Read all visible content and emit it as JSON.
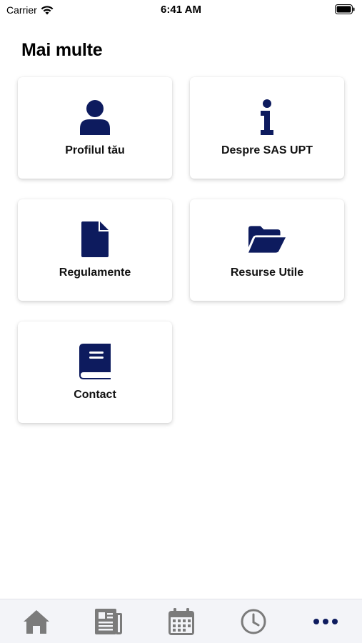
{
  "status_bar": {
    "carrier": "Carrier",
    "time": "6:41 AM"
  },
  "page": {
    "title": "Mai multe"
  },
  "accent_color": "#0d1b5e",
  "tab_inactive_color": "#7b7b7b",
  "cards": [
    {
      "label": "Profilul tău",
      "icon": "user-icon"
    },
    {
      "label": "Despre SAS UPT",
      "icon": "info-icon"
    },
    {
      "label": "Regulamente",
      "icon": "document-icon"
    },
    {
      "label": "Resurse Utile",
      "icon": "folder-open-icon"
    },
    {
      "label": "Contact",
      "icon": "book-icon"
    }
  ],
  "tabs": [
    {
      "icon": "home-icon",
      "active": false
    },
    {
      "icon": "newspaper-icon",
      "active": false
    },
    {
      "icon": "calendar-icon",
      "active": false
    },
    {
      "icon": "clock-icon",
      "active": false
    },
    {
      "icon": "more-dots-icon",
      "active": true
    }
  ]
}
